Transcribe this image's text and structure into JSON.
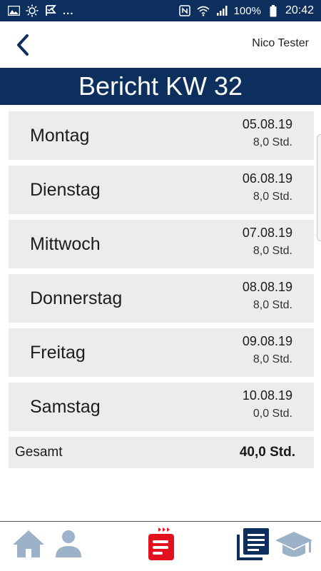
{
  "status_bar": {
    "left_icons": [
      "image-icon",
      "sun-icon",
      "check-flag-icon"
    ],
    "overflow": "...",
    "right_icons": [
      "nfc-icon",
      "wifi-icon",
      "signal-icon",
      "battery-icon"
    ],
    "battery": "100%",
    "time": "20:42"
  },
  "header": {
    "user_name": "Nico Tester"
  },
  "title": "Bericht KW 32",
  "days": [
    {
      "name": "Montag",
      "date": "05.08.19",
      "hours": "8,0 Std."
    },
    {
      "name": "Dienstag",
      "date": "06.08.19",
      "hours": "8,0 Std."
    },
    {
      "name": "Mittwoch",
      "date": "07.08.19",
      "hours": "8,0 Std."
    },
    {
      "name": "Donnerstag",
      "date": "08.08.19",
      "hours": "8,0 Std."
    },
    {
      "name": "Freitag",
      "date": "09.08.19",
      "hours": "8,0 Std."
    },
    {
      "name": "Samstag",
      "date": "10.08.19",
      "hours": "0,0 Std."
    }
  ],
  "total": {
    "label": "Gesamt",
    "value": "40,0 Std."
  },
  "bottom_nav": {
    "items": [
      "home-icon",
      "user-icon",
      "report-icon",
      "documents-icon",
      "graduation-cap-icon"
    ]
  },
  "colors": {
    "primary": "#0d2f5e",
    "accent": "#e3101f",
    "row_bg": "#ebecec",
    "nav_icon": "#9bb2c8"
  }
}
